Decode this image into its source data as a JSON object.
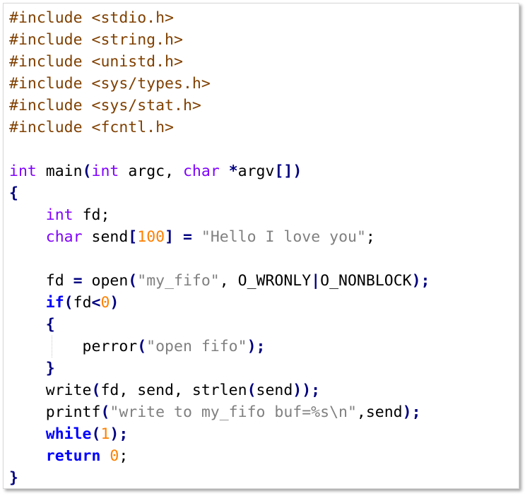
{
  "editor": {
    "lines": [
      [
        {
          "t": "#include <stdio.h>",
          "c": "pp"
        }
      ],
      [
        {
          "t": "#include <string.h>",
          "c": "pp"
        }
      ],
      [
        {
          "t": "#include <unistd.h>",
          "c": "pp"
        }
      ],
      [
        {
          "t": "#include <sys/types.h>",
          "c": "pp"
        }
      ],
      [
        {
          "t": "#include <sys/stat.h>",
          "c": "pp"
        }
      ],
      [
        {
          "t": "#include <fcntl.h>",
          "c": "pp"
        }
      ],
      [],
      [
        {
          "t": "int",
          "c": "kw"
        },
        {
          "t": " main"
        },
        {
          "t": "(",
          "c": "op"
        },
        {
          "t": "int",
          "c": "kw"
        },
        {
          "t": " argc, "
        },
        {
          "t": "char",
          "c": "kw"
        },
        {
          "t": " "
        },
        {
          "t": "*",
          "c": "op"
        },
        {
          "t": "argv"
        },
        {
          "t": "[])",
          "c": "op"
        }
      ],
      [
        {
          "t": "{",
          "c": "op"
        }
      ],
      [
        {
          "t": "    "
        },
        {
          "t": "int",
          "c": "kw"
        },
        {
          "t": " fd;"
        }
      ],
      [
        {
          "t": "    "
        },
        {
          "t": "char",
          "c": "kw"
        },
        {
          "t": " send"
        },
        {
          "t": "[",
          "c": "op"
        },
        {
          "t": "100",
          "c": "num"
        },
        {
          "t": "]",
          "c": "op"
        },
        {
          "t": " "
        },
        {
          "t": "=",
          "c": "op"
        },
        {
          "t": " "
        },
        {
          "t": "\"Hello I love you\"",
          "c": "str"
        },
        {
          "t": ";"
        }
      ],
      [],
      [
        {
          "t": "    fd "
        },
        {
          "t": "=",
          "c": "op"
        },
        {
          "t": " open"
        },
        {
          "t": "(",
          "c": "op"
        },
        {
          "t": "\"my_fifo\"",
          "c": "str"
        },
        {
          "t": ", O_WRONLY"
        },
        {
          "t": "|",
          "c": "op"
        },
        {
          "t": "O_NONBLOCK"
        },
        {
          "t": ");",
          "c": "op"
        }
      ],
      [
        {
          "t": "    "
        },
        {
          "t": "if",
          "c": "kwb"
        },
        {
          "t": "(",
          "c": "op"
        },
        {
          "t": "fd"
        },
        {
          "t": "<",
          "c": "op"
        },
        {
          "t": "0",
          "c": "num"
        },
        {
          "t": ")",
          "c": "op"
        }
      ],
      [
        {
          "t": "    "
        },
        {
          "t": "{",
          "c": "op"
        }
      ],
      [
        {
          "t": "        perror"
        },
        {
          "t": "(",
          "c": "op"
        },
        {
          "t": "\"open fifo\"",
          "c": "str"
        },
        {
          "t": ");",
          "c": "op"
        }
      ],
      [
        {
          "t": "    "
        },
        {
          "t": "}",
          "c": "op"
        }
      ],
      [
        {
          "t": "    write"
        },
        {
          "t": "(",
          "c": "op"
        },
        {
          "t": "fd, send, strlen"
        },
        {
          "t": "(",
          "c": "op"
        },
        {
          "t": "send"
        },
        {
          "t": "));",
          "c": "op"
        }
      ],
      [
        {
          "t": "    printf"
        },
        {
          "t": "(",
          "c": "op"
        },
        {
          "t": "\"write to my_fifo buf=%s\\n\"",
          "c": "str"
        },
        {
          "t": ",send"
        },
        {
          "t": ");",
          "c": "op"
        }
      ],
      [
        {
          "t": "    "
        },
        {
          "t": "while",
          "c": "kwb"
        },
        {
          "t": "(",
          "c": "op"
        },
        {
          "t": "1",
          "c": "num"
        },
        {
          "t": ");",
          "c": "op"
        }
      ],
      [
        {
          "t": "    "
        },
        {
          "t": "return",
          "c": "kwb"
        },
        {
          "t": " "
        },
        {
          "t": "0",
          "c": "num"
        },
        {
          "t": ";"
        }
      ],
      [
        {
          "t": "}",
          "c": "op"
        }
      ]
    ]
  }
}
